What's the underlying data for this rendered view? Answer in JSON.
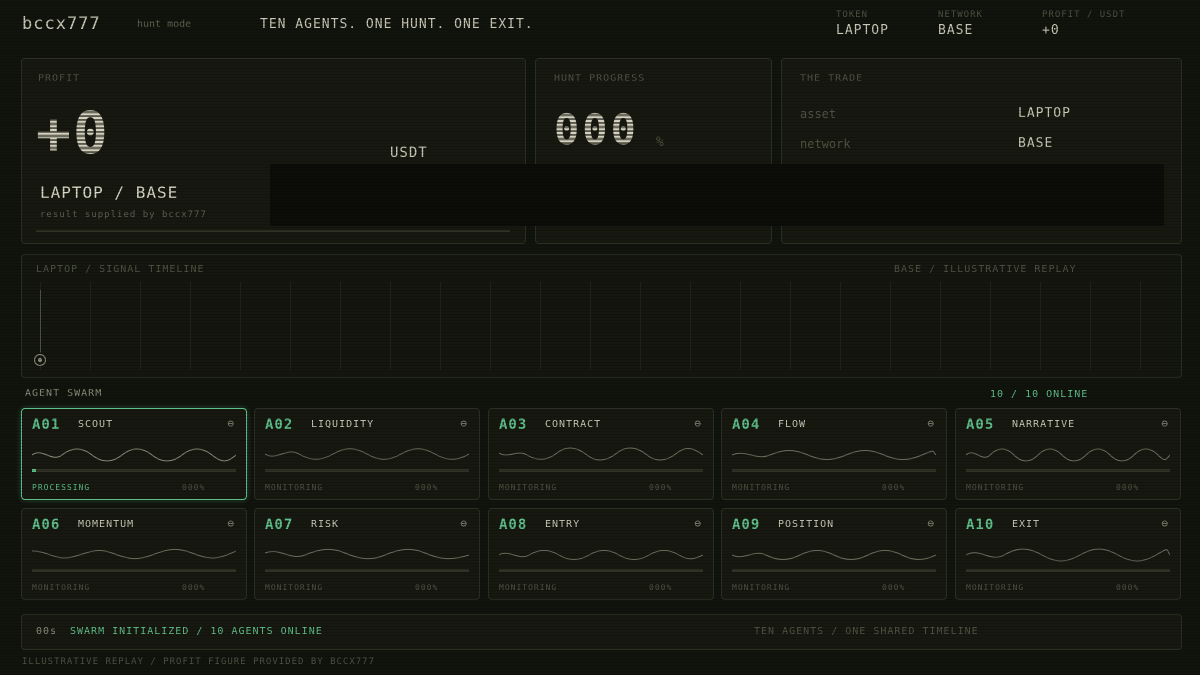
{
  "header": {
    "brand": "bccx777",
    "mode": "hunt mode",
    "tagline": "TEN AGENTS. ONE HUNT. ONE EXIT.",
    "stats": [
      {
        "label": "TOKEN",
        "value": "LAPTOP"
      },
      {
        "label": "NETWORK",
        "value": "BASE"
      },
      {
        "label": "PROFIT / USDT",
        "value": "+0"
      }
    ]
  },
  "profit": {
    "label": "PROFIT",
    "value": "+0",
    "unit": "USDT",
    "pair": "LAPTOP / BASE",
    "note": "result supplied by bccx777"
  },
  "hunt": {
    "label": "HUNT PROGRESS",
    "value": "000",
    "unit": "%"
  },
  "trade": {
    "label": "THE TRADE",
    "rows": [
      {
        "key": "asset",
        "value": "LAPTOP"
      },
      {
        "key": "network",
        "value": "BASE"
      }
    ]
  },
  "timeline": {
    "left_label": "LAPTOP / SIGNAL TIMELINE",
    "right_label": "BASE / ILLUSTRATIVE REPLAY"
  },
  "swarm": {
    "title": "AGENT SWARM",
    "online": "10 / 10 ONLINE",
    "agents": [
      {
        "id": "A01",
        "name": "SCOUT",
        "status": "PROCESSING",
        "pct": "000%",
        "progress": 0.02
      },
      {
        "id": "A02",
        "name": "LIQUIDITY",
        "status": "MONITORING",
        "pct": "000%",
        "progress": 0.0
      },
      {
        "id": "A03",
        "name": "CONTRACT",
        "status": "MONITORING",
        "pct": "000%",
        "progress": 0.0
      },
      {
        "id": "A04",
        "name": "FLOW",
        "status": "MONITORING",
        "pct": "000%",
        "progress": 0.0
      },
      {
        "id": "A05",
        "name": "NARRATIVE",
        "status": "MONITORING",
        "pct": "000%",
        "progress": 0.0
      },
      {
        "id": "A06",
        "name": "MOMENTUM",
        "status": "MONITORING",
        "pct": "000%",
        "progress": 0.0
      },
      {
        "id": "A07",
        "name": "RISK",
        "status": "MONITORING",
        "pct": "000%",
        "progress": 0.0
      },
      {
        "id": "A08",
        "name": "ENTRY",
        "status": "MONITORING",
        "pct": "000%",
        "progress": 0.0
      },
      {
        "id": "A09",
        "name": "POSITION",
        "status": "MONITORING",
        "pct": "000%",
        "progress": 0.0
      },
      {
        "id": "A10",
        "name": "EXIT",
        "status": "MONITORING",
        "pct": "000%",
        "progress": 0.0
      }
    ]
  },
  "statusbar": {
    "time": "00s",
    "message": "SWARM INITIALIZED / 10 AGENTS ONLINE",
    "right": "TEN AGENTS / ONE SHARED TIMELINE"
  },
  "footer": {
    "text": "ILLUSTRATIVE REPLAY / PROFIT FIGURE PROVIDED BY BCCX777"
  },
  "colors": {
    "accent": "#5fbf8a",
    "background": "#11130d",
    "panel": "#171911"
  }
}
